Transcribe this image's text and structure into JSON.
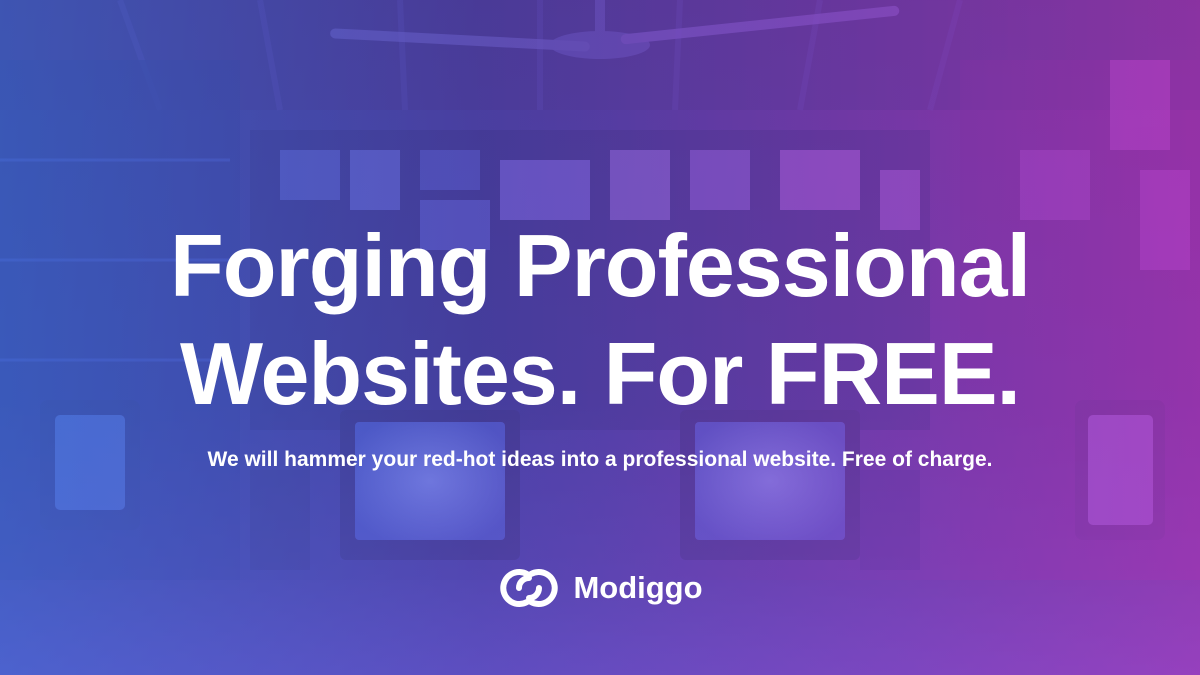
{
  "hero": {
    "headline_line1": "Forging Professional",
    "headline_line2": "Websites. For FREE.",
    "subheadline": "We will hammer your red-hot ideas into a professional website. Free of charge."
  },
  "brand": {
    "name": "Modiggo",
    "logo_icon": "interlocking-rings-logo"
  },
  "colors": {
    "text": "#ffffff",
    "gradient_left": "#4a7fe6",
    "gradient_mid": "#6a54d6",
    "gradient_right": "#c43cc8"
  }
}
